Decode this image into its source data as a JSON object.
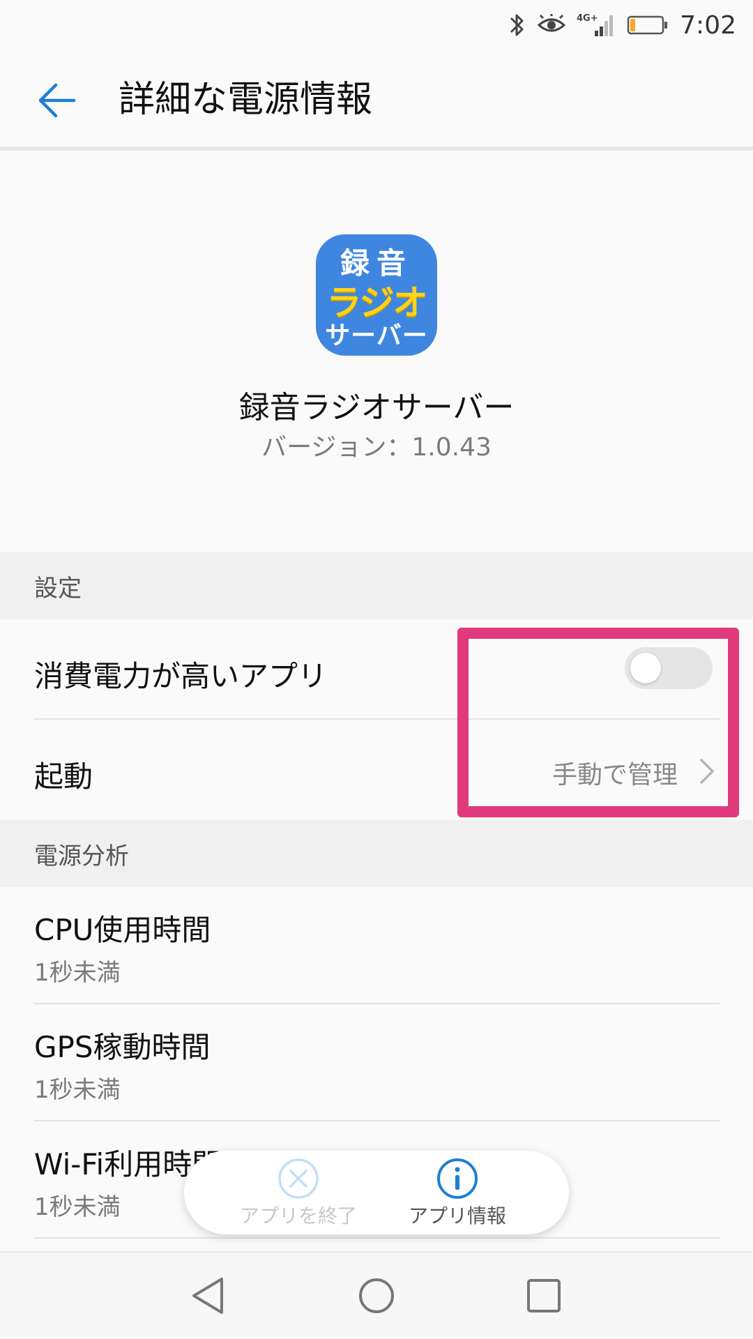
{
  "status_bar": {
    "network_label": "4G+",
    "time": "7:02",
    "battery_level": 0.15,
    "battery_color": "#f5a623"
  },
  "header": {
    "title": "詳細な電源情報"
  },
  "app": {
    "icon_line1": "録音",
    "icon_line2": "ラジオ",
    "icon_line3": "サーバー",
    "name": "録音ラジオサーバー",
    "version": "バージョン：1.0.43"
  },
  "settings_section": {
    "header": "設定",
    "high_power_label": "消費電力が高いアプリ",
    "high_power_enabled": false,
    "launch_label": "起動",
    "launch_value": "手動で管理"
  },
  "power_section": {
    "header": "電源分析",
    "items": [
      {
        "label": "CPU使用時間",
        "value": "1秒未満"
      },
      {
        "label": "GPS稼動時間",
        "value": "1秒未満"
      },
      {
        "label": "Wi-Fi利用時間",
        "value": "1秒未満"
      }
    ]
  },
  "float_bar": {
    "close_label": "アプリを終了",
    "info_label": "アプリ情報"
  },
  "colors": {
    "accent": "#1f7fd6",
    "highlight": "#e03a7d",
    "app_icon_bg": "#3f86e0",
    "app_icon_yellow": "#ffd21a"
  }
}
